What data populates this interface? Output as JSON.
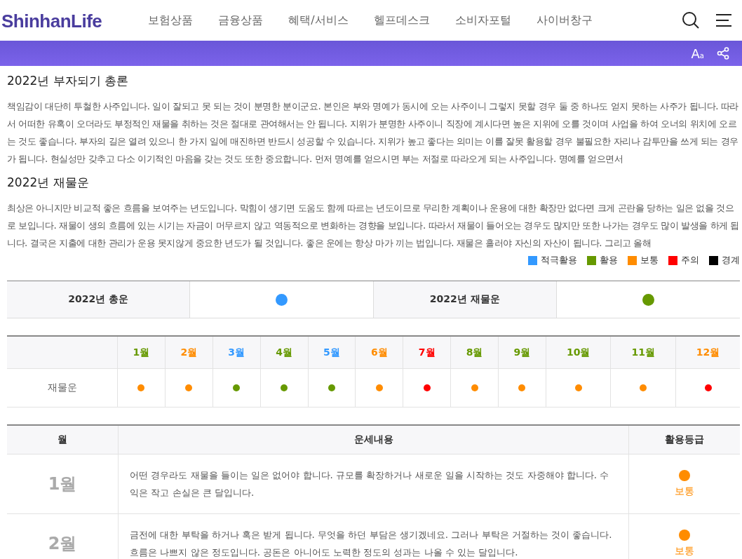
{
  "header": {
    "logo": "ShinhanLife",
    "nav": [
      "보험상품",
      "금융상품",
      "혜택/서비스",
      "헬프데스크",
      "소비자포털",
      "사이버창구"
    ]
  },
  "toolbar": {
    "font_button": "A",
    "font_button_small": "a"
  },
  "sections": [
    {
      "title": "2022년 부자되기 총론",
      "text": "책임감이 대단히 투철한 사주입니다. 일이 잘되고 못 되는 것이 분명한 분이군요. 본인은 부와 명예가 동시에 오는 사주이니 그렇지 못할 경우 둘 중 하나도 얻지 못하는 사주가 됩니다. 따라서 어떠한 유혹이 오더라도 부정적인 재물을 취하는 것은 절대로 관여해서는 안 됩니다. 지위가 분명한 사주이니 직장에 계시다면 높은 지위에 오를 것이며 사업을 하여 오너의 위치에 오르는 것도 좋습니다. 부자의 길은 열려 있으니 한 가지 일에 매진하면 반드시 성공할 수 있습니다. 지위가 높고 좋다는 의미는 이를 잘못 활용할 경우 불필요한 자리나 감투만을 쓰게 되는 경우가 됩니다. 현실성만 갖추고 다소 이기적인 마음을 갖는 것도 또한 중요합니다. 먼저 명예를 얻으시면 부는 저절로 따라오게 되는 사주입니다. 명예를 얻으면서"
    },
    {
      "title": "2022년 재물운",
      "text": "최상은 아니지만 비교적 좋은 흐름을 보여주는 년도입니다. 막힘이 생기면 도움도 함께 따르는 년도이므로 무리한 계획이나 운용에 대한 확장만 없다면 크게 곤란을 당하는 일은 없을 것으로 보입니다. 재물이 생의 흐름에 있는 시기는 자금이 머무르지 않고 역동적으로 변화하는 경향을 보입니다. 따라서 재물이 들어오는 경우도 많지만 또한 나가는 경우도 많이 발생을 하게 됩니다. 결국은 지출에 대한 관리가 운용 못지않게 중요한 년도가 될 것입니다. 좋은 운에는 항상 마가 끼는 법입니다. 재물은 흘러야 자신의 자산이 됩니다. 그리고 올해"
    }
  ],
  "legend": [
    {
      "label": "적극활용",
      "color": "#3399ff"
    },
    {
      "label": "활용",
      "color": "#669900"
    },
    {
      "label": "보통",
      "color": "#ff8c00"
    },
    {
      "label": "주의",
      "color": "#ff0000"
    },
    {
      "label": "경계",
      "color": "#000000"
    }
  ],
  "summary": [
    {
      "label": "2022년 총운",
      "color": "#3399ff"
    },
    {
      "label": "2022년 재물운",
      "color": "#669900"
    }
  ],
  "monthly": {
    "row_label": "재물운",
    "headers": [
      {
        "label": "1월",
        "color": "#669900"
      },
      {
        "label": "2월",
        "color": "#ff8c00"
      },
      {
        "label": "3월",
        "color": "#3399ff"
      },
      {
        "label": "4월",
        "color": "#669900"
      },
      {
        "label": "5월",
        "color": "#3399ff"
      },
      {
        "label": "6월",
        "color": "#ff8c00"
      },
      {
        "label": "7월",
        "color": "#ff0000"
      },
      {
        "label": "8월",
        "color": "#669900"
      },
      {
        "label": "9월",
        "color": "#669900"
      },
      {
        "label": "10월",
        "color": "#669900"
      },
      {
        "label": "11월",
        "color": "#669900"
      },
      {
        "label": "12월",
        "color": "#ff8c00"
      }
    ],
    "dots": [
      {
        "color": "#ff8c00"
      },
      {
        "color": "#ff8c00"
      },
      {
        "color": "#669900"
      },
      {
        "color": "#669900"
      },
      {
        "color": "#669900"
      },
      {
        "color": "#ff8c00"
      },
      {
        "color": "#ff0000"
      },
      {
        "color": "#ff8c00"
      },
      {
        "color": "#ff8c00"
      },
      {
        "color": "#ff8c00"
      },
      {
        "color": "#ff8c00"
      },
      {
        "color": "#ff0000"
      }
    ]
  },
  "detail": {
    "columns": [
      "월",
      "운세내용",
      "활용등급"
    ],
    "rows": [
      {
        "month": "1월",
        "text": "어떤 경우라도 재물을 들이는 일은 없어야 합니다. 규모를 확장하거나 새로운 일을 시작하는 것도 자중해야 합니다. 수익은 작고 손실은 큰 달입니다.",
        "grade": "보통",
        "color": "#ff8c00"
      },
      {
        "month": "2월",
        "text": "금전에 대한 부탁을 하거나 혹은 받게 됩니다. 무엇을 하던 부담은 생기겠네요. 그러나 부탁은 거절하는 것이 좋습니다. 흐름은 나쁘지 않은 정도입니다. 공돈은 아니어도 노력한 정도의 성과는 나올 수 있는 달입니다.",
        "grade": "보통",
        "color": "#ff8c00"
      }
    ]
  }
}
